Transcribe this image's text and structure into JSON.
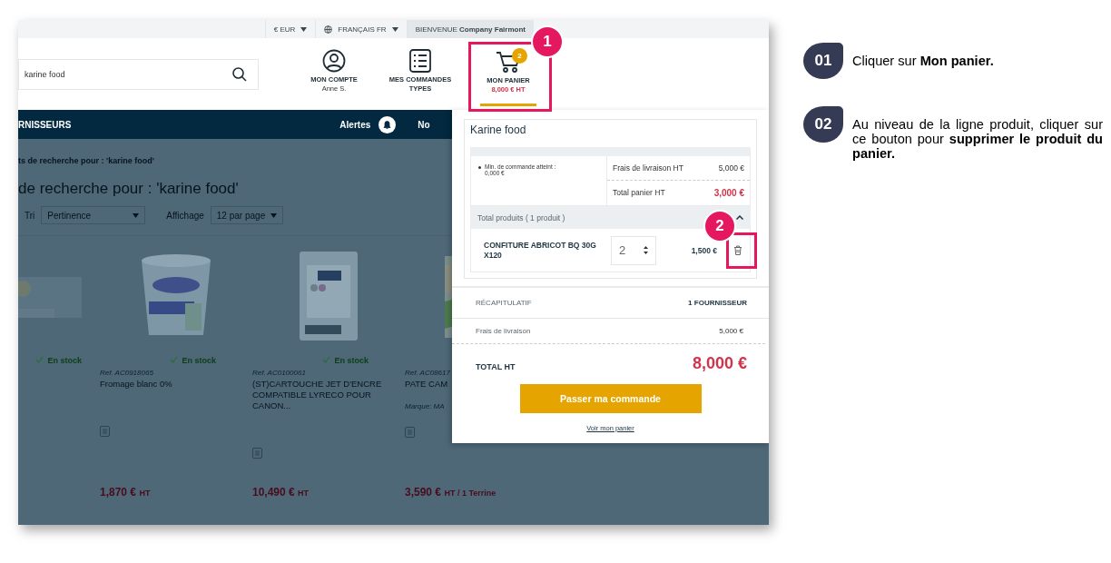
{
  "top_bar": {
    "currency": "€ EUR",
    "language": "FRANÇAIS FR",
    "welcome": "BIENVENUE",
    "company": "Company Fairmont"
  },
  "search": {
    "value": "karine food"
  },
  "header_links": [
    {
      "kind": "account",
      "label": "MON COMPTE",
      "sub": "Anne S.",
      "selected": false
    },
    {
      "kind": "orders",
      "label": "MES COMMANDES TYPES",
      "selected": false
    },
    {
      "kind": "cart",
      "label": "MON PANIER",
      "sub": "8,000 € HT",
      "badge": "2",
      "selected": true
    }
  ],
  "nav": {
    "title": "RNISSEURS",
    "alerts": "Alertes",
    "next": "No"
  },
  "breadcrumb": "ts de recherche pour : 'karine food'",
  "heading": "de recherche pour : 'karine food'",
  "sort": {
    "label": "Tri",
    "value": "Pertinence"
  },
  "display": {
    "label": "Affichage",
    "value": "12 par page"
  },
  "products": [
    {
      "stock": "En stock"
    },
    {
      "stock": "En stock",
      "ref": "Ref. AC0918065",
      "name": "Fromage blanc 0%",
      "price": "1,870 €",
      "unit": "HT"
    },
    {
      "stock": "En stock",
      "ref": "Ref. AC0100061",
      "name": "(ST)CARTOUCHE JET D'ENCRE COMPATIBLE LYRECO POUR CANON...",
      "price": "10,490 €",
      "unit": "HT"
    },
    {
      "ref": "Ref. AC08617",
      "name": "PATE CAM",
      "brand": "Marque: MA",
      "price": "3,590 €",
      "unit": "HT / 1 Terrine"
    }
  ],
  "cart": {
    "supplier": "Karine food",
    "min_note": "Min. de commande atteint : 0,000 €",
    "fees_label": "Frais de livraison HT",
    "fees": "5,000 €",
    "total_label": "Total panier HT",
    "total": "3,000 €",
    "products_label": "Total produits ( 1 produit )",
    "expanded": true,
    "items": [
      {
        "name": "CONFITURE ABRICOT BQ 30G X120",
        "quantity": "2",
        "price": "1,500 €"
      }
    ],
    "summary_label": "RÉCAPITULATIF",
    "suppliers": "1 FOURNISSEUR",
    "delivery_label": "Frais de livraison",
    "delivery": "5,000 €",
    "total_ht_label": "TOTAL HT",
    "total_ht": "8,000 €",
    "order_button": "Passer ma commande",
    "view_link": "Voir mon panier"
  },
  "markers": [
    "1",
    "2"
  ],
  "steps": [
    {
      "number": "01",
      "text": "Cliquer sur **Mon panier.**"
    },
    {
      "number": "02",
      "text": "Au niveau de la ligne produit, cliquer sur ce bouton pour **supprimer le produit du panier.**"
    }
  ]
}
